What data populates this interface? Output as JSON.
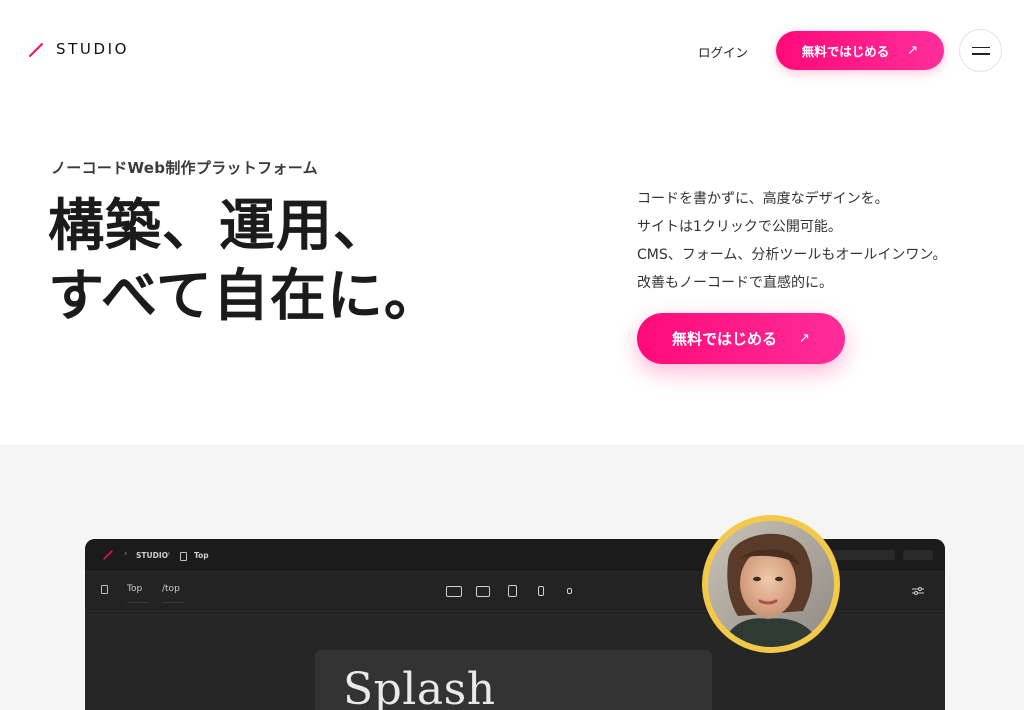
{
  "header": {
    "logo_text": "STUDIO",
    "login_label": "ログイン",
    "cta_label": "無料ではじめる",
    "cta_arrow": "↗",
    "menu_icon": "hamburger-icon"
  },
  "hero": {
    "tagline": "ノーコードWeb制作プラットフォーム",
    "headline_lines": [
      "構築、運用、",
      "すべて自在に。"
    ],
    "features": [
      "コードを書かずに、高度なデザインを。",
      "サイトは1クリックで公開可能。",
      "CMS、フォーム、分析ツールもオールインワン。",
      "改善もノーコードで直感的に。"
    ],
    "cta_label": "無料ではじめる",
    "cta_arrow": "↗"
  },
  "editor_preview": {
    "breadcrumb": [
      "STUDIO",
      "Top"
    ],
    "page_name": "Top",
    "page_path": "/top",
    "canvas_title": "Splash"
  },
  "colors": {
    "accent": "#ff0a78",
    "accent_light": "#ff2d9a",
    "avatar_ring": "#f3c94a",
    "section_bg": "#f5f5f6",
    "editor_bg": "#1e1e1e"
  }
}
